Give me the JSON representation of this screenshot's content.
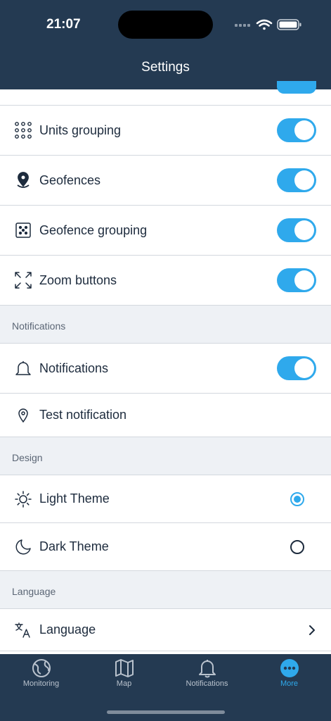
{
  "status": {
    "time": "21:07"
  },
  "header": {
    "title": "Settings"
  },
  "rows": {
    "units_grouping": "Units grouping",
    "geofences": "Geofences",
    "geofence_grouping": "Geofence grouping",
    "zoom_buttons": "Zoom buttons",
    "notifications": "Notifications",
    "test_notification": "Test notification",
    "light_theme": "Light Theme",
    "dark_theme": "Dark Theme",
    "language": "Language"
  },
  "sections": {
    "notifications": "Notifications",
    "design": "Design",
    "language": "Language"
  },
  "tabs": [
    {
      "label": "Monitoring",
      "icon": "globe-icon"
    },
    {
      "label": "Map",
      "icon": "map-icon"
    },
    {
      "label": "Notifications",
      "icon": "bell-icon"
    },
    {
      "label": "More",
      "icon": "more-icon"
    }
  ],
  "colors": {
    "accent": "#2fa9ec",
    "header": "#243a52",
    "section": "#eef1f5"
  }
}
